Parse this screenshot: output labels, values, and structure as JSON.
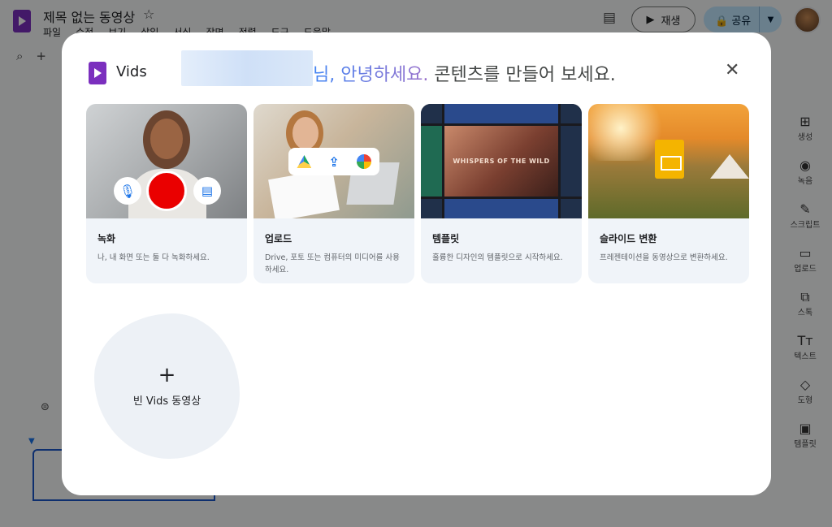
{
  "app": {
    "title": "제목 없는 동영상",
    "menu": [
      "파일",
      "수정",
      "보기",
      "삽입",
      "서식",
      "장면",
      "정렬",
      "도구",
      "도움말"
    ],
    "play_label": "재생",
    "share_label": "공유",
    "rail": [
      {
        "icon": "generate-icon",
        "label": "생성"
      },
      {
        "icon": "record-icon",
        "label": "녹음"
      },
      {
        "icon": "script-icon",
        "label": "스크립트"
      },
      {
        "icon": "upload-icon",
        "label": "업로드"
      },
      {
        "icon": "stock-icon",
        "label": "스톡"
      },
      {
        "icon": "text-icon",
        "label": "텍스트"
      },
      {
        "icon": "shape-icon",
        "label": "도형"
      },
      {
        "icon": "template-icon",
        "label": "템플릿"
      }
    ]
  },
  "dialog": {
    "brand": "Vids",
    "greeting_highlight": "님, 안녕하세요.",
    "greeting_rest": "콘텐츠를 만들어 보세요.",
    "cards": [
      {
        "title": "녹화",
        "description": "나, 내 화면 또는 둘 다 녹화하세요."
      },
      {
        "title": "업로드",
        "description": "Drive, 포토 또는 컴퓨터의 미디어를 사용하세요."
      },
      {
        "title": "템플릿",
        "description": "훌륭한 디자인의 템플릿으로 시작하세요."
      },
      {
        "title": "슬라이드 변환",
        "description": "프레젠테이션을 동영상으로 변환하세요."
      }
    ],
    "template_preview_text": "WHISPERS OF THE WILD",
    "blank_label": "빈 Vids 동영상"
  }
}
